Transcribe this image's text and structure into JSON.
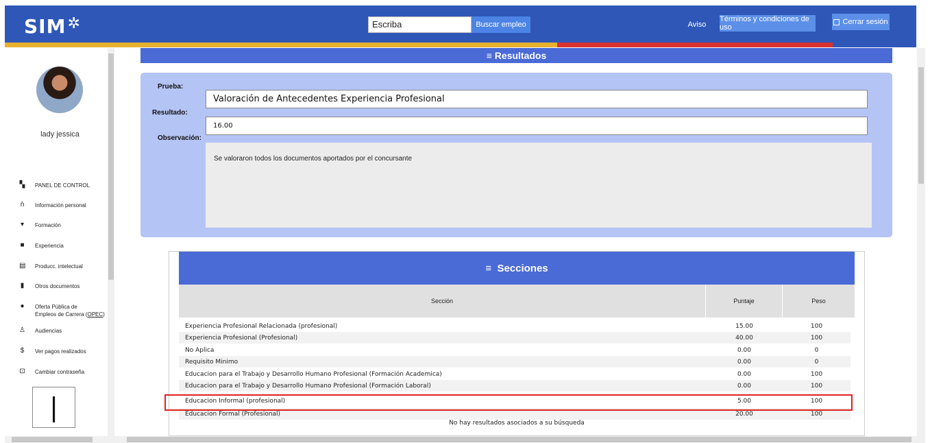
{
  "header": {
    "logo": "SIM",
    "logo_icon": "gear-icon",
    "search_placeholder": "Escriba",
    "search_value": "Escriba",
    "buscar_label": "Buscar empleo",
    "aviso_label": "Aviso",
    "terminos_label": "Términos y condiciones de uso",
    "cerrar_label": "Cerrar sesión",
    "colors": {
      "bar": "#2e57b8",
      "stripe_yellow": "#e7b02e",
      "stripe_red": "#d83232"
    }
  },
  "sidebar": {
    "user_name": "lady jessica",
    "items": [
      {
        "label": "PANEL DE CONTROL",
        "icon": "dashboard-icon"
      },
      {
        "label": "Información personal",
        "icon": "people-icon"
      },
      {
        "label": "Formación",
        "icon": "graduation-icon"
      },
      {
        "label": "Experiencia",
        "icon": "briefcase-icon"
      },
      {
        "label": "Producc. intelectual",
        "icon": "book-icon"
      },
      {
        "label": "Otros documentos",
        "icon": "document-icon"
      },
      {
        "label": "Oferta Pública de Empleos de Carrera (OPEC)",
        "label_line1": "Oferta Pública de",
        "label_line2a": "Empleos de Carrera (",
        "label_line2b": "OPEC",
        "label_line2c": ")",
        "icon": "globe-icon"
      },
      {
        "label": "Audiencias",
        "icon": "audience-icon"
      },
      {
        "label": "Ver pagos realizados",
        "icon": "dollar-icon"
      },
      {
        "label": "Cambiar contraseña",
        "icon": "lock-icon"
      }
    ]
  },
  "resultados": {
    "title": "Resultados",
    "prueba_label": "Prueba:",
    "prueba_value": "Valoración de Antecedentes Experiencia Profesional",
    "resultado_label": "Resultado:",
    "resultado_value": "16.00",
    "observacion_label": "Observación:",
    "observacion_value": "Se valoraron todos los documentos aportados por el concursante"
  },
  "secciones": {
    "title": "Secciones",
    "columns": [
      "Sección",
      "Puntaje",
      "Peso"
    ],
    "rows": [
      {
        "seccion": "Experiencia Profesional Relacionada (profesional)",
        "puntaje": "15.00",
        "peso": "100"
      },
      {
        "seccion": "Experiencia Profesional (Profesional)",
        "puntaje": "40.00",
        "peso": "100"
      },
      {
        "seccion": "No Aplica",
        "puntaje": "0.00",
        "peso": "0"
      },
      {
        "seccion": "Requisito Minimo",
        "puntaje": "0.00",
        "peso": "0"
      },
      {
        "seccion": "Educacion para el Trabajo y Desarrollo Humano Profesional (Formación Academica)",
        "puntaje": "0.00",
        "peso": "100"
      },
      {
        "seccion": "Educacion para el Trabajo y Desarrollo Humano Profesional (Formación Laboral)",
        "puntaje": "0.00",
        "peso": "100"
      },
      {
        "seccion": "Educacion Informal (profesional)",
        "puntaje": "5.00",
        "peso": "100"
      },
      {
        "seccion": "Educacion Formal (Profesional)",
        "puntaje": "20.00",
        "peso": "100"
      }
    ],
    "no_results": "No hay resultados asociados a su búsqueda",
    "highlighted_row": 6
  }
}
